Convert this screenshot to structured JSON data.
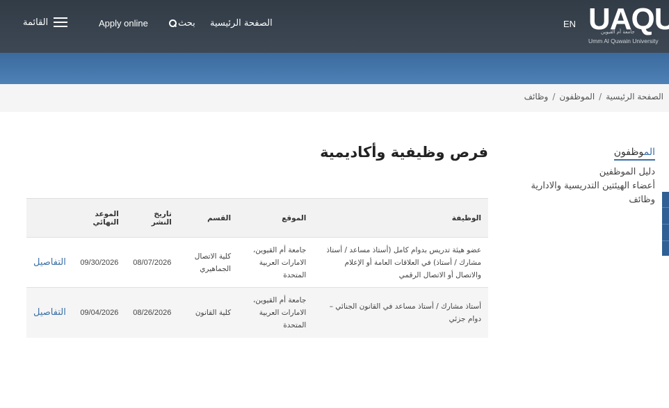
{
  "header": {
    "logo_mark": "UAQU",
    "logo_subtitle": "Umm Al Quwain University",
    "logo_arabic": "جامعة أم القيوين",
    "lang_toggle": "EN",
    "nav_home": "الصفحة الرئيسية",
    "nav_search": "بحث",
    "nav_apply": "Apply online",
    "nav_menu": "القائمة"
  },
  "breadcrumb": {
    "items": [
      "الصفحة الرئيسية",
      "الموظفون",
      "وظائف"
    ],
    "separator": "/"
  },
  "sidebar": {
    "title_accent": "الم",
    "title_rest": "وظفون",
    "links": [
      "دليل الموظفين",
      "أعضاء الهيئتين التدريسية والادارية",
      "وظائف"
    ]
  },
  "page_title": "فرص وظيفية وأكاديمية",
  "table": {
    "headers": {
      "job": "الوظيفة",
      "location": "الموقع",
      "department": "القسم",
      "published": "تاريخ النشر",
      "deadline": "الموعد النهائي"
    },
    "rows": [
      {
        "job": "عضو هيئة تدريس بدوام كامل (أستاذ مساعد / أستاذ مشارك / أستاذ) في العلاقات العامة أو الإعلام والاتصال أو الاتصال الرقمي",
        "location": "جامعة أم القيوين، الامارات العربية المتحدة",
        "department": "كلية الاتصال الجماهيري",
        "published": "08/07/2026",
        "deadline": "09/30/2026",
        "details": "التفاصيل"
      },
      {
        "job": "أستاذ مشارك / أستاذ مساعد في القانون الجنائي – دوام جزئي",
        "location": "جامعة أم القيوين، الامارات العربية المتحدة",
        "department": "كلية القانون",
        "published": "08/26/2026",
        "deadline": "09/04/2026",
        "details": "التفاصيل"
      }
    ]
  },
  "colors": {
    "header_bg": "#3a4450",
    "band_blue": "#4577ad",
    "accent": "#3a6ea5"
  }
}
